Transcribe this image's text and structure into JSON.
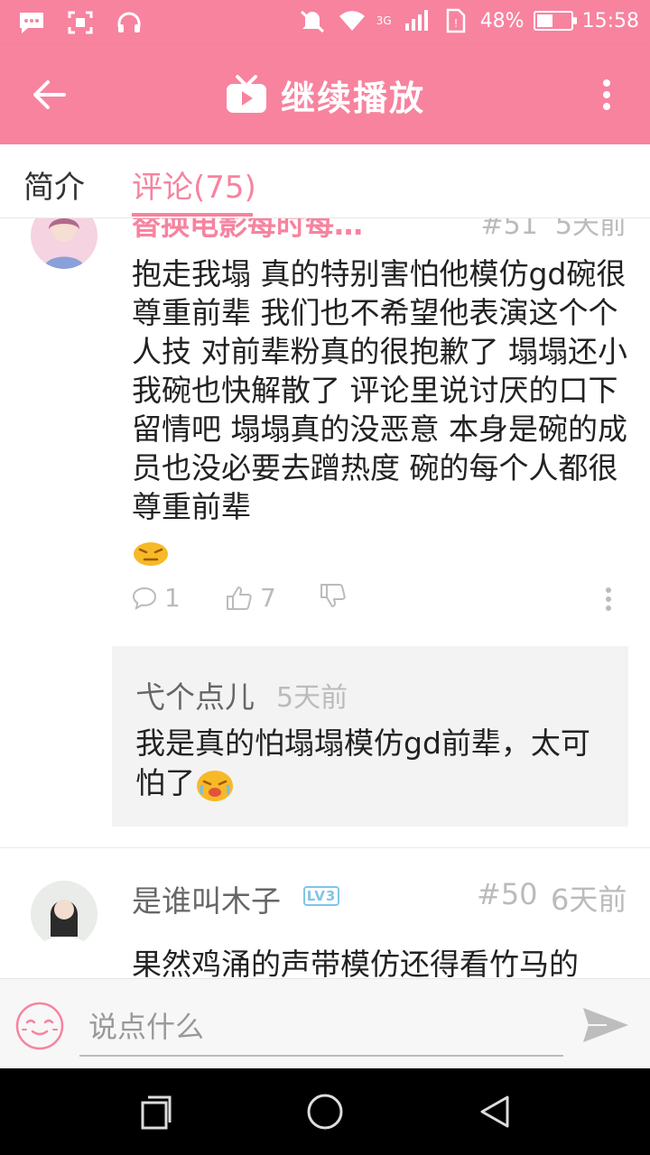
{
  "status_bar": {
    "battery_percent_text": "48%",
    "battery_level": 0.48,
    "time": "15:58",
    "network": "3G"
  },
  "header": {
    "title": "继续播放"
  },
  "tabs": [
    {
      "label": "简介",
      "active": false
    },
    {
      "label": "评论(75)",
      "active": true
    }
  ],
  "comments": [
    {
      "user_name_partial": "替换电影每时每…",
      "floor_partial": "#51",
      "time_partial": "5天前",
      "text": "抱走我塌 真的特别害怕他模仿gd碗很尊重前辈 我们也不希望他表演这个个人技  对前辈粉真的很抱歉了 塌塌还小 我碗也快解散了 评论里说讨厌的口下留情吧  塌塌真的没恶意  本身是碗的成员也没必要去蹭热度 碗的每个人都很尊重前辈",
      "reply_count": "1",
      "like_count": "7",
      "reply": {
        "user_name": "弋个点儿",
        "time": "5天前",
        "text": "我是真的怕塌塌模仿gd前辈，太可怕了"
      }
    },
    {
      "user_name": "是谁叫木子",
      "level_badge": "LV3",
      "floor": "#50",
      "time": "6天前",
      "text": "果然鸡涌的声带模仿还得看竹马的"
    }
  ],
  "input": {
    "placeholder": "说点什么"
  },
  "colors": {
    "accent": "#f7839f",
    "muted": "#bbbbbb",
    "reply_bg": "#f3f3f3"
  },
  "icons": [
    "message-icon",
    "mute-icon",
    "headphones-icon",
    "wifi-icon",
    "signal-icon",
    "back-arrow-icon",
    "tv-icon",
    "more-vertical-icon",
    "comment-icon",
    "thumbs-up-icon",
    "thumbs-down-icon",
    "smile-icon",
    "send-icon",
    "recents-icon",
    "home-icon",
    "back-icon"
  ]
}
